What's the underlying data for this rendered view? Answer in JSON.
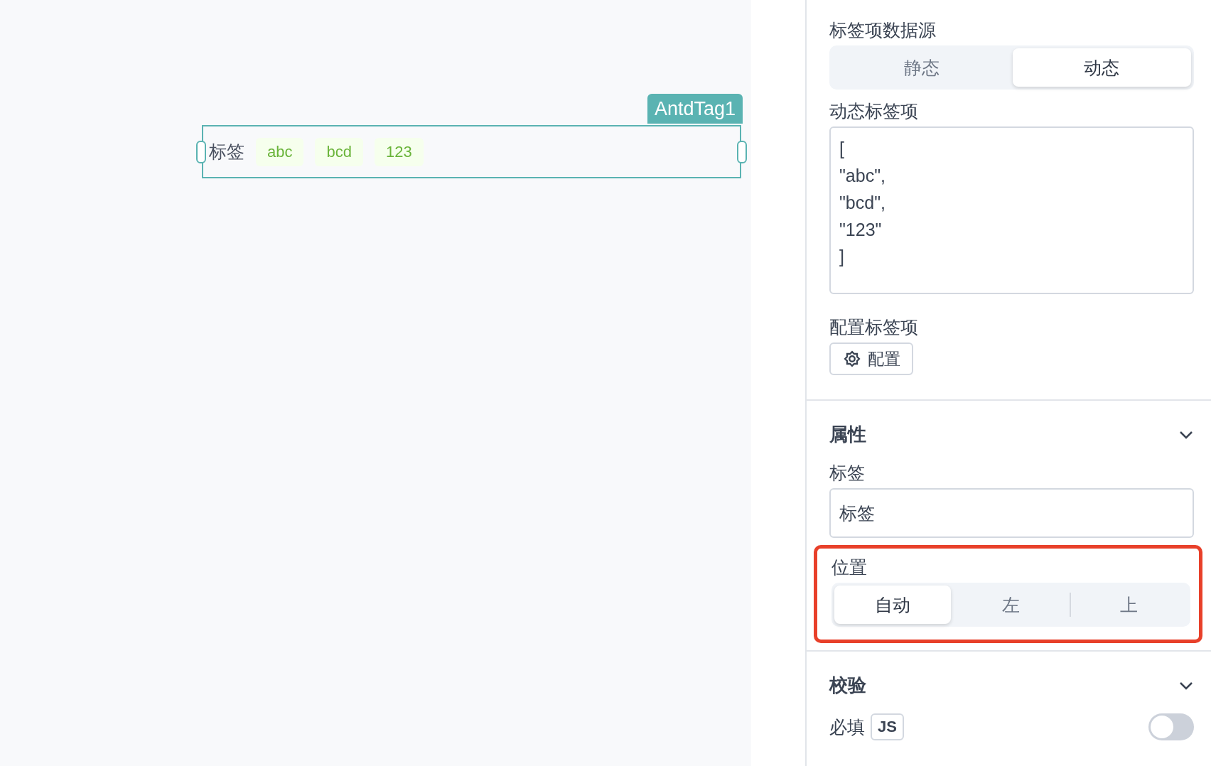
{
  "canvas": {
    "widget": {
      "name": "AntdTag1",
      "selected": true,
      "label": "标签",
      "tags": [
        {
          "text": "abc"
        },
        {
          "text": "bcd"
        },
        {
          "text": "123"
        }
      ]
    }
  },
  "panel": {
    "data_source": {
      "label": "标签项数据源",
      "options": [
        {
          "label": "静态",
          "selected": false
        },
        {
          "label": "动态",
          "selected": true
        }
      ]
    },
    "dynamic_items": {
      "label": "动态标签项",
      "value": "[\n\"abc\",\n\"bcd\",\n\"123\"\n]"
    },
    "configure_items": {
      "label": "配置标签项",
      "button": "配置"
    },
    "properties": {
      "title": "属性",
      "expanded": true,
      "label_field": {
        "label": "标签",
        "value": "标签"
      },
      "position": {
        "label": "位置",
        "highlighted": true,
        "options": [
          {
            "label": "自动",
            "selected": true
          },
          {
            "label": "左",
            "selected": false
          },
          {
            "label": "上",
            "selected": false
          }
        ]
      }
    },
    "validation": {
      "title": "校验",
      "expanded": true,
      "required": {
        "label": "必填",
        "badge": "JS",
        "on": false
      }
    }
  }
}
